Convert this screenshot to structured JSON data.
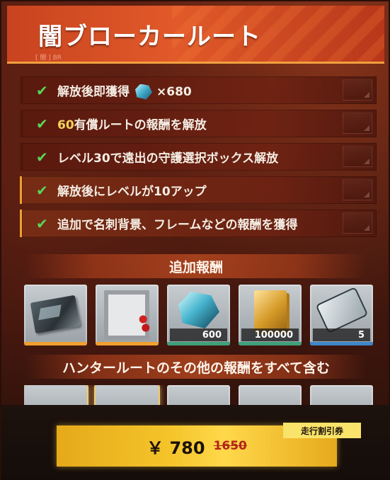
{
  "header": {
    "title": "闇ブローカールート",
    "sub": "[ 闇 ] BR"
  },
  "benefits": [
    {
      "pre": "解放後即獲得",
      "gem": "crystal-icon",
      "post": "×680",
      "highlight": false
    },
    {
      "y": "60",
      "text": "有償ルートの報酬を解放",
      "highlight": false
    },
    {
      "text": "レベル30で遠出の守護選択ボックス解放",
      "highlight": false
    },
    {
      "text": "解放後にレベルが10アップ",
      "highlight": true
    },
    {
      "text": "追加で名刺背景、フレームなどの報酬を獲得",
      "highlight": true
    }
  ],
  "sections": {
    "extra": "追加報酬",
    "hunter": "ハンタールートのその他の報酬をすべて含む"
  },
  "rewards": [
    {
      "icon": "name-card-icon",
      "qty": "",
      "bar": "#f0a030"
    },
    {
      "icon": "frame-icon",
      "qty": "",
      "bar": "#f0a030"
    },
    {
      "icon": "crystal-icon",
      "qty": "600",
      "bar": "#3fa07a"
    },
    {
      "icon": "gold-bar-icon",
      "qty": "100000",
      "bar": "#3fa07a"
    },
    {
      "icon": "usb-key-icon",
      "qty": "5",
      "bar": "#3d86c8"
    }
  ],
  "purchase": {
    "currency": "￥",
    "price": "780",
    "old_price": "1650",
    "coupon": "走行割引券"
  },
  "colors": {
    "accent": "#f0a030",
    "check": "#5ad65a",
    "button": "#f4c42a"
  }
}
